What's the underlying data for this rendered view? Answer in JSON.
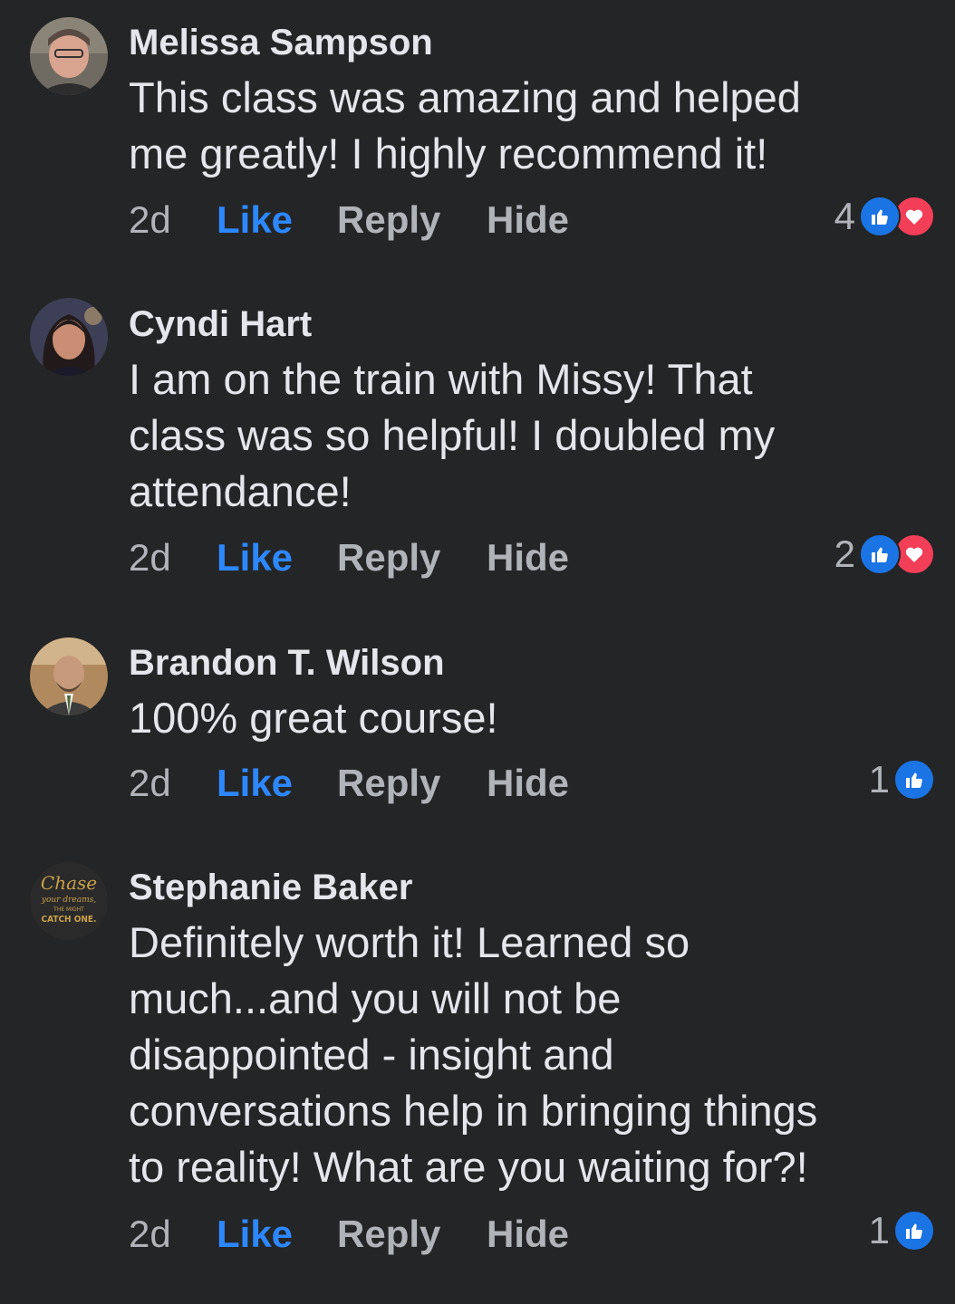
{
  "comments": [
    {
      "author": "Melissa Sampson",
      "text": "This class was amazing and helped\nme greatly! I highly recommend it!",
      "time": "2d",
      "like_label": "Like",
      "reply_label": "Reply",
      "hide_label": "Hide",
      "reaction_count": "4",
      "reactions": [
        "like-icon",
        "love-icon"
      ]
    },
    {
      "author": "Cyndi Hart",
      "text": "I am  on the train with Missy! That\nclass was so helpful! I doubled my\nattendance!",
      "time": "2d",
      "like_label": "Like",
      "reply_label": "Reply",
      "hide_label": "Hide",
      "reaction_count": "2",
      "reactions": [
        "like-icon",
        "love-icon"
      ]
    },
    {
      "author": "Brandon T. Wilson",
      "text": "100% great course!",
      "time": "2d",
      "like_label": "Like",
      "reply_label": "Reply",
      "hide_label": "Hide",
      "reaction_count": "1",
      "reactions": [
        "like-icon"
      ]
    },
    {
      "author": "Stephanie Baker",
      "text": "Definitely worth it!  Learned so\nmuch...and you will not be\ndisappointed - insight and\nconversations help in bringing things\nto reality!  What are you waiting for?!",
      "time": "2d",
      "like_label": "Like",
      "reply_label": "Reply",
      "hide_label": "Hide",
      "reaction_count": "1",
      "reactions": [
        "like-icon"
      ],
      "avatar_text": [
        "Chase",
        "your dreams,",
        "THE MIGHT",
        "CATCH ONE."
      ]
    }
  ],
  "colors": {
    "background": "#242526",
    "text": "#e4e6eb",
    "secondary": "#b0b3b8",
    "link": "#2d88ff",
    "like": "#1b74e4",
    "love": "#f33e58"
  }
}
